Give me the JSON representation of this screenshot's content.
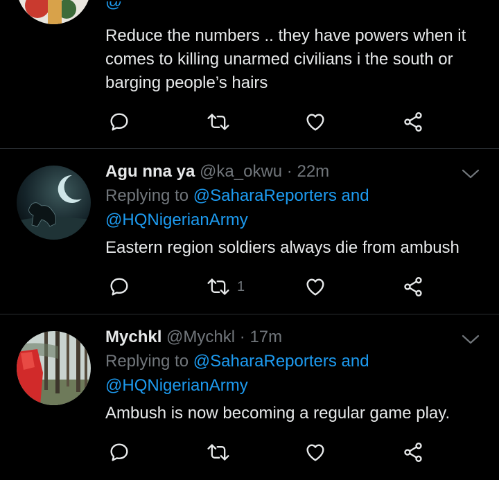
{
  "tweets": [
    {
      "partial_header": "@",
      "body": "Reduce the numbers .. they have powers when it comes to killing unarmed civilians i the south or barging people’s hairs",
      "actions": {
        "reply_count": "",
        "retweet_count": "",
        "like_count": ""
      }
    },
    {
      "name": "Agu nna ya",
      "handle": "@ka_okwu",
      "separator": "·",
      "time": "22m",
      "replying_prefix": "Replying to ",
      "mention1": "@SaharaReporters",
      "and_text": " and",
      "mention2": "@HQNigerianArmy",
      "body": "Eastern region soldiers always die from ambush",
      "actions": {
        "reply_count": "",
        "retweet_count": "1",
        "like_count": ""
      }
    },
    {
      "name": "Mychkl",
      "handle": "@Mychkl",
      "separator": "·",
      "time": "17m",
      "replying_prefix": "Replying to ",
      "mention1": "@SaharaReporters",
      "and_text": " and",
      "mention2": "@HQNigerianArmy",
      "body": "Ambush is now becoming a regular game play.",
      "actions": {
        "reply_count": "",
        "retweet_count": "",
        "like_count": ""
      }
    }
  ],
  "colors": {
    "background": "#000000",
    "text": "#e7e9ea",
    "muted": "#71767b",
    "link": "#1d9bf0",
    "divider": "#2a2f33"
  },
  "icons": [
    "reply-icon",
    "retweet-icon",
    "like-icon",
    "share-icon",
    "chevron-down-icon"
  ]
}
